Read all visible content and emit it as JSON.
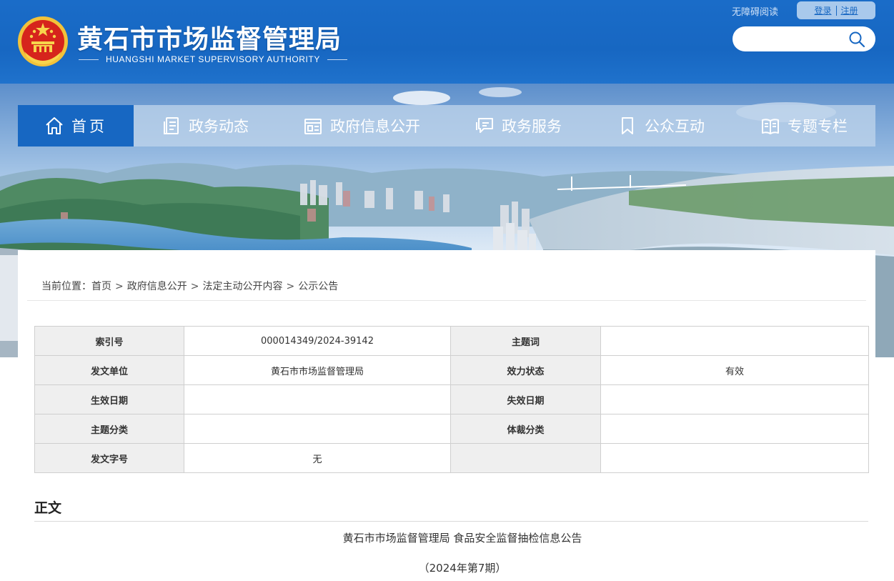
{
  "header": {
    "title": "黄石市市场监督管理局",
    "subtitle": "HUANGSHI MARKET SUPERVISORY AUTHORITY",
    "accessibility": "无障碍阅读",
    "login": "登录",
    "register": "注册",
    "search_placeholder": ""
  },
  "nav": {
    "items": [
      {
        "label": "首页",
        "icon": "home-icon",
        "active": true
      },
      {
        "label": "政务动态",
        "icon": "document-icon"
      },
      {
        "label": "政府信息公开",
        "icon": "info-board-icon"
      },
      {
        "label": "政务服务",
        "icon": "chat-bubble-icon"
      },
      {
        "label": "公众互动",
        "icon": "bookmark-icon"
      },
      {
        "label": "专题专栏",
        "icon": "open-book-icon"
      }
    ]
  },
  "breadcrumb": {
    "prefix": "当前位置：",
    "items": [
      "首页",
      "政府信息公开",
      "法定主动公开内容",
      "公示公告"
    ],
    "separator": ">"
  },
  "meta": {
    "rows": [
      {
        "l1": "索引号",
        "v1": "000014349/2024-39142",
        "l2": "主题词",
        "v2": ""
      },
      {
        "l1": "发文单位",
        "v1": "黄石市市场监督管理局",
        "l2": "效力状态",
        "v2": "有效"
      },
      {
        "l1": "生效日期",
        "v1": "",
        "l2": "失效日期",
        "v2": ""
      },
      {
        "l1": "主题分类",
        "v1": "",
        "l2": "体裁分类",
        "v2": ""
      },
      {
        "l1": "发文字号",
        "v1": "无",
        "l2": "",
        "v2": ""
      }
    ]
  },
  "content": {
    "section_title": "正文",
    "doc_title": "黄石市市场监督管理局 食品安全监督抽检信息公告",
    "doc_period": "（2024年第7期）"
  },
  "colors": {
    "header_blue": "#1767c2",
    "nav_active": "#1767c2",
    "table_label_bg": "#efefef"
  }
}
